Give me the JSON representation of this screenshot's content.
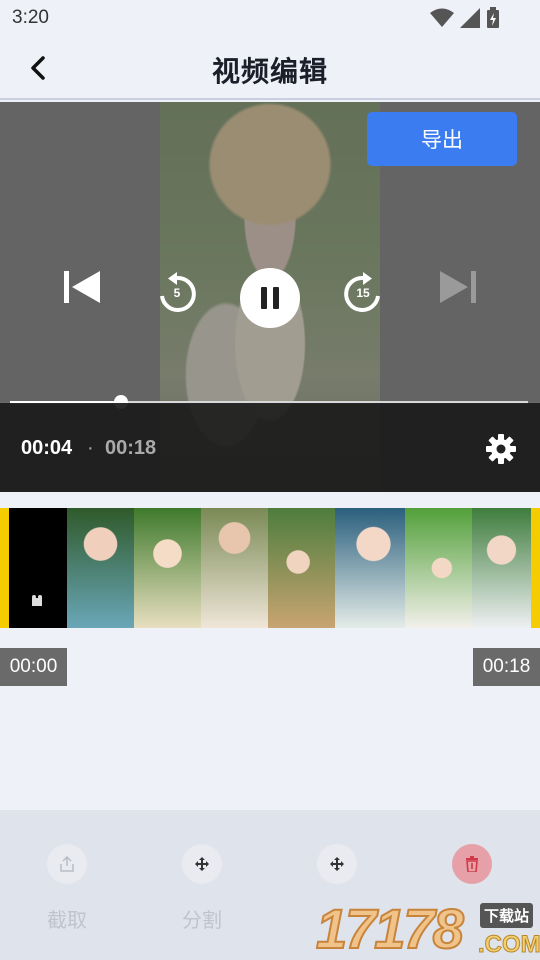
{
  "status": {
    "time": "3:20"
  },
  "header": {
    "title": "视频编辑"
  },
  "player": {
    "export_label": "导出",
    "rewind_seconds": "5",
    "forward_seconds": "15",
    "current_time": "00:04",
    "separator": "·",
    "total_time": "00:18",
    "progress": 0.215
  },
  "timeline": {
    "start_label": "00:00",
    "end_label": "00:18"
  },
  "toolbar": {
    "items": [
      {
        "label": "截取",
        "icon": "share-icon"
      },
      {
        "label": "分割",
        "icon": "move-icon"
      },
      {
        "label": "",
        "icon": "move-icon"
      },
      {
        "label": "",
        "icon": "trash-icon"
      }
    ]
  },
  "watermark": {
    "digits": "17178",
    "tag": "下载站",
    "suffix": ".COM"
  },
  "colors": {
    "accent": "#3b7cf0",
    "trim_handle": "#f5cc00",
    "delete": "#e6a0a8"
  }
}
